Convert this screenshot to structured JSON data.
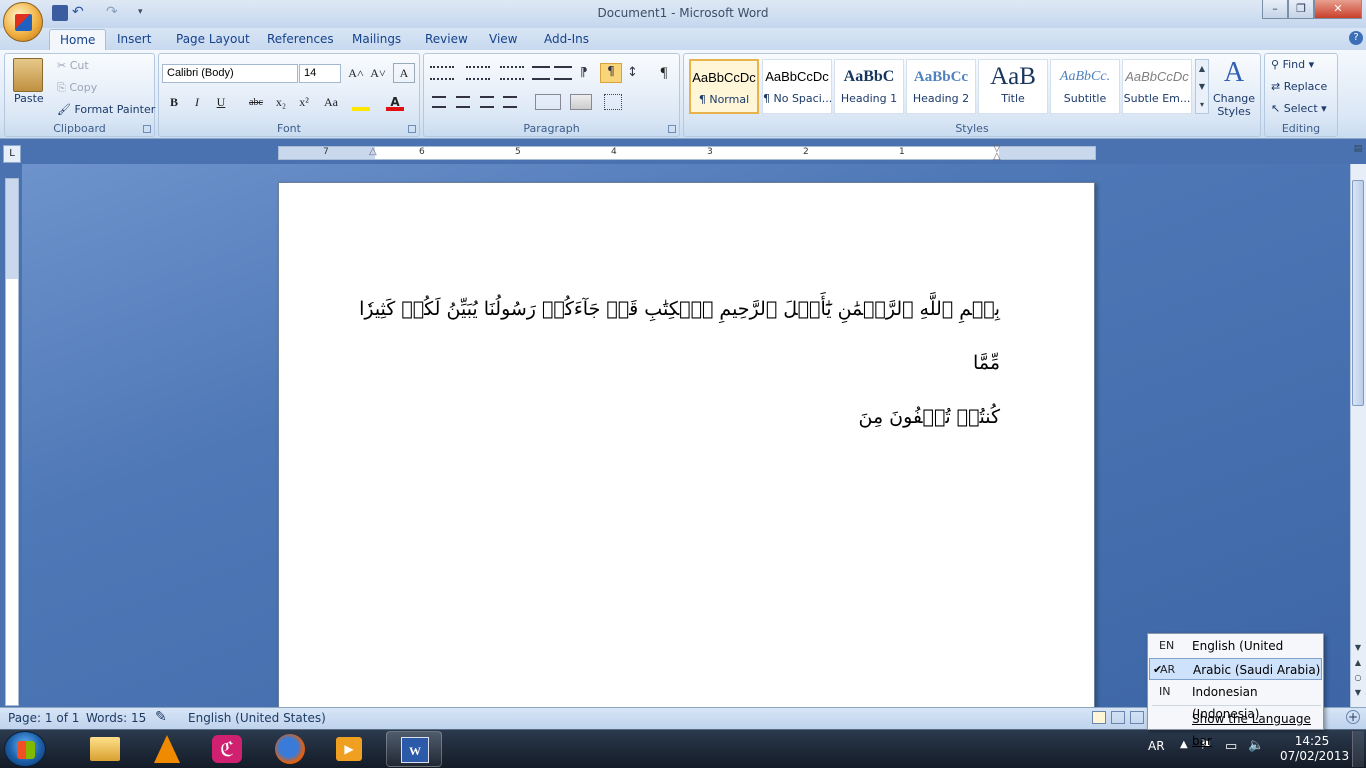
{
  "window": {
    "title": "Document1 - Microsoft Word",
    "minimize": "–",
    "restore": "❐",
    "close": "✕"
  },
  "tabs": [
    "Home",
    "Insert",
    "Page Layout",
    "References",
    "Mailings",
    "Review",
    "View",
    "Add-Ins"
  ],
  "clipboard": {
    "paste": "Paste",
    "cut": "Cut",
    "copy": "Copy",
    "format_painter": "Format Painter",
    "label": "Clipboard"
  },
  "font": {
    "name": "Calibri (Body)",
    "size": "14",
    "label": "Font",
    "bold": "B",
    "italic": "I",
    "underline": "U",
    "strike": "abc",
    "sub": "x₂",
    "sup": "x²",
    "case": "Aa",
    "grow": "A˄",
    "shrink": "A˅",
    "clear": "A"
  },
  "paragraph": {
    "label": "Paragraph",
    "show_marks": "¶"
  },
  "styles": {
    "label": "Styles",
    "items": [
      {
        "preview": "AaBbCcDc",
        "name": "¶ Normal"
      },
      {
        "preview": "AaBbCcDc",
        "name": "¶ No Spaci..."
      },
      {
        "preview": "AaBbC",
        "name": "Heading 1"
      },
      {
        "preview": "AaBbCc",
        "name": "Heading 2"
      },
      {
        "preview": "AaB",
        "name": "Title"
      },
      {
        "preview": "AaBbCc.",
        "name": "Subtitle"
      },
      {
        "preview": "AaBbCcDc",
        "name": "Subtle Em..."
      }
    ],
    "change_styles": "Change Styles"
  },
  "editing": {
    "find": "Find",
    "replace": "Replace",
    "select": "Select",
    "label": "Editing"
  },
  "ruler": {
    "numbers": [
      "7",
      "6",
      "5",
      "4",
      "3",
      "2",
      "1"
    ]
  },
  "document": {
    "line1": "بِسۡمِ ٱللَّهِ ٱلرَّحۡمَٰنِ يَٰٓأَهۡلَ ٱلرَّحِيمِ ٱلۡكِتَٰبِ قَدۡ جَآءَكُمۡ رَسُولُنَا يُبَيِّنُ لَكُمۡ كَثِيرٗا مِّمَّا",
    "line2": "كُنتُمۡ تُخۡفُونَ مِنَ"
  },
  "status": {
    "page": "Page: 1 of 1",
    "words": "Words: 15",
    "language": "English (United States)"
  },
  "language_menu": {
    "items": [
      {
        "code": "EN",
        "name": "English (United States)",
        "checked": false
      },
      {
        "code": "AR",
        "name": "Arabic (Saudi Arabia)",
        "checked": true
      },
      {
        "code": "IN",
        "name": "Indonesian (Indonesia)",
        "checked": false
      }
    ],
    "show_bar": "Show the Language bar",
    "check": "✔"
  },
  "tray": {
    "lang": "AR",
    "time": "14:25",
    "date": "07/02/2013"
  },
  "colors": {
    "ribbon_text": "#15428b",
    "accent": "#e8b24c"
  }
}
